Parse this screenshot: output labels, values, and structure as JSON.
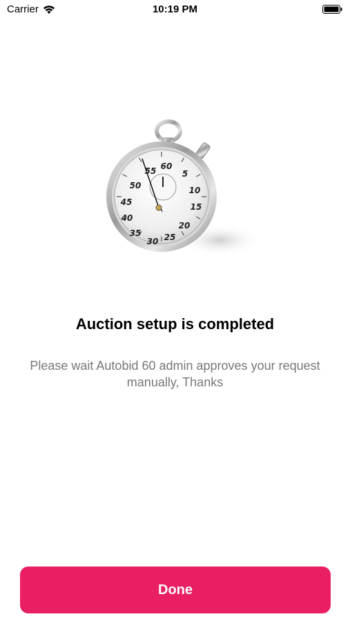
{
  "status_bar": {
    "carrier": "Carrier",
    "time": "10:19 PM",
    "wifi_icon": "wifi-icon",
    "battery_icon": "battery-icon"
  },
  "illustration": {
    "icon": "stopwatch-icon",
    "dial_numbers": [
      "60",
      "5",
      "10",
      "15",
      "20",
      "25",
      "30",
      "35",
      "40",
      "45",
      "50",
      "55"
    ]
  },
  "content": {
    "title": "Auction setup is completed",
    "message": "Please wait Autobid 60 admin approves your request manually, Thanks"
  },
  "actions": {
    "done_label": "Done"
  },
  "colors": {
    "accent": "#E91E63",
    "message_text": "#777777"
  }
}
